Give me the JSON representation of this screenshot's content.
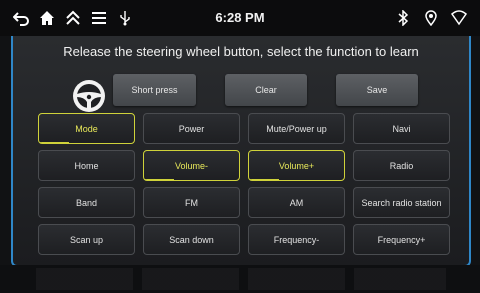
{
  "status_bar": {
    "time": "6:28 PM",
    "left_icons": [
      "back-icon",
      "home-icon",
      "double-chevron-up-icon",
      "menu-icon",
      "usb-icon"
    ],
    "right_icons": [
      "bluetooth-icon",
      "location-pin-icon",
      "wifi-signal-icon"
    ]
  },
  "instruction": "Release the steering wheel button, select the function to learn",
  "actions": {
    "short_press": "Short press",
    "clear": "Clear",
    "save": "Save"
  },
  "functions": [
    {
      "label": "Mode",
      "selected": true
    },
    {
      "label": "Power",
      "selected": false
    },
    {
      "label": "Mute/Power up",
      "selected": false
    },
    {
      "label": "Navi",
      "selected": false
    },
    {
      "label": "Home",
      "selected": false
    },
    {
      "label": "Volume-",
      "selected": true
    },
    {
      "label": "Volume+",
      "selected": true
    },
    {
      "label": "Radio",
      "selected": false
    },
    {
      "label": "Band",
      "selected": false
    },
    {
      "label": "FM",
      "selected": false
    },
    {
      "label": "AM",
      "selected": false
    },
    {
      "label": "Search radio station",
      "selected": false
    },
    {
      "label": "Scan up",
      "selected": false
    },
    {
      "label": "Scan down",
      "selected": false
    },
    {
      "label": "Frequency-",
      "selected": false
    },
    {
      "label": "Frequency+",
      "selected": false
    }
  ],
  "colors": {
    "accent_selected": "#cfd23a",
    "frame_border": "#2f87c8"
  }
}
